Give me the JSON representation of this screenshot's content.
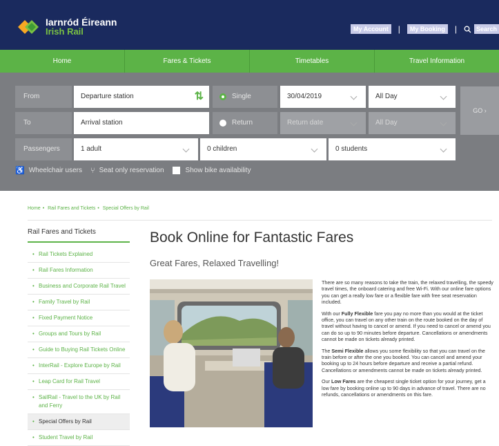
{
  "header": {
    "logo_line1": "Iarnród Éireann",
    "logo_line2": "Irish Rail",
    "links": [
      "My Account",
      "My Booking"
    ],
    "search_label": "Search"
  },
  "nav": [
    "Home",
    "Fares & Tickets",
    "Timetables",
    "Travel Information"
  ],
  "booking": {
    "from_label": "From",
    "from_placeholder": "Departure station",
    "to_label": "To",
    "to_placeholder": "Arrival station",
    "single_label": "Single",
    "return_label": "Return",
    "date": "30/04/2019",
    "time": "All Day",
    "return_date": "Return date",
    "return_time": "All Day",
    "passengers_label": "Passengers",
    "adults": "1 adult",
    "children": "0 children",
    "students": "0 students",
    "go_label": "GO ›",
    "wheelchair": "Wheelchair users",
    "seat_only": "Seat only reservation",
    "bike": "Show bike availability"
  },
  "breadcrumb": [
    "Home",
    "Rail Fares and Tickets",
    "Special Offers by Rail"
  ],
  "sidebar": {
    "title": "Rail Fares and Tickets",
    "items": [
      "Rail Tickets Explained",
      "Rail Fares Information",
      "Business and Corporate Rail Travel",
      "Family Travel by Rail",
      "Fixed Payment Notice",
      "Groups and Tours by Rail",
      "Guide to Buying Rail Tickets Online",
      "InterRail - Explore Europe by Rail",
      "Leap Card for Rail Travel",
      "SailRail - Travel to the UK by Rail and Ferry",
      "Special Offers by Rail",
      "Student Travel by Rail"
    ]
  },
  "main": {
    "title": "Book Online for Fantastic Fares",
    "subtitle": "Great Fares, Relaxed Travelling!",
    "p1": "There are so many reasons to take the train, the relaxed travelling, the speedy travel times, the onboard catering and free Wi-Fi. With our online fare options you can get a really low fare or a flexible fare with free seat reservation included.",
    "p2_bold": "Fully Flexible",
    "p2_pre": "With our ",
    "p2_post": " fare you pay no more than you would at the ticket office, you can travel on any other train on the route booked on the day of travel without having to cancel or amend. If you need to cancel or amend you can do so up to 90 minutes before departure. Cancellations or amendments cannot be made on tickets already printed.",
    "p3_pre": "The ",
    "p3_bold": "Semi Flexible",
    "p3_post": " allows you some flexibility so that you can travel on the train before or after the one you booked. You can cancel and amend your booking up to 24 hours before departure and receive a partial refund. Cancellations or amendments cannot be made on tickets already printed.",
    "p4_pre": "Our ",
    "p4_bold": "Low Fares",
    "p4_post": " are the cheapest single ticket option for your journey, get a low fare by booking online up to 90 days in advance of travel. There are no refunds, cancellations or amendments on this fare."
  },
  "colors": {
    "header_bg": "#1a2a5e",
    "nav_green": "#5cb347",
    "panel_grey": "#7b7d81"
  }
}
